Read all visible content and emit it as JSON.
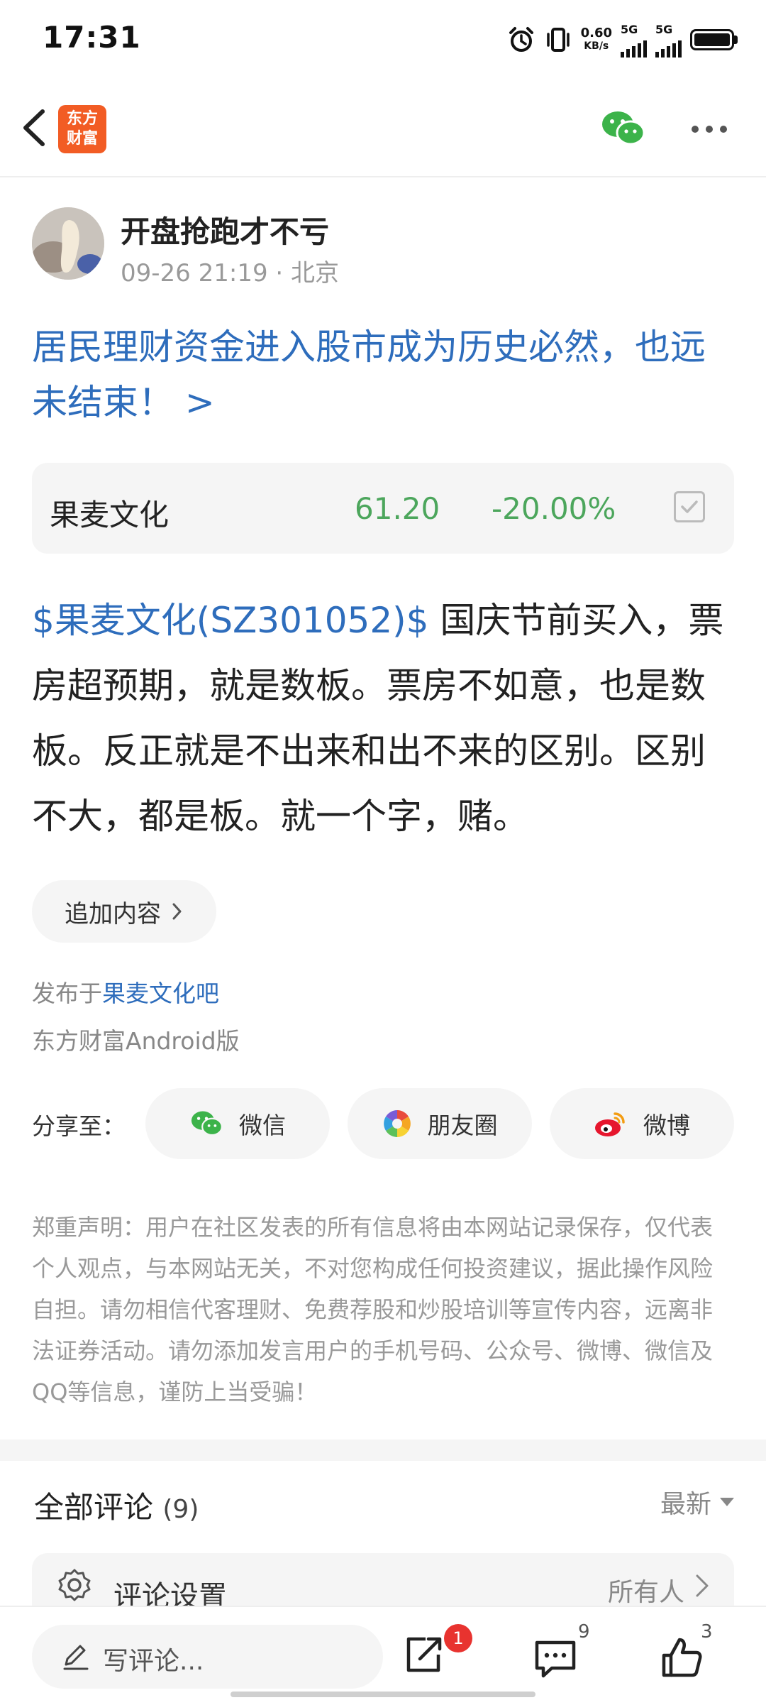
{
  "status_bar": {
    "time": "17:31",
    "net_speed_value": "0.60",
    "net_speed_unit": "KB/s",
    "signal1_label": "5G",
    "signal2_label": "5G"
  },
  "nav": {
    "logo_line1": "东方",
    "logo_line2": "财富"
  },
  "author": {
    "name": "开盘抢跑才不亏",
    "meta": "09-26 21:19 · 北京"
  },
  "post": {
    "title": "居民理财资金进入股市成为历史必然，也远未结束！ >",
    "stock_tag": "$果麦文化(SZ301052)$",
    "body": " 国庆节前买入，票房超预期，就是数板。票房不如意，也是数板。反正就是不出来和出不来的区别。区别不大，都是板。就一个字，赌。"
  },
  "stock_card": {
    "name": "果麦文化",
    "price": "61.20",
    "change": "-20.00%",
    "color_down": "#4ca65c"
  },
  "add_content_label": "追加内容",
  "publish": {
    "prefix": "发布于",
    "bar_name": "果麦文化吧",
    "client": "东方财富Android版"
  },
  "share": {
    "label": "分享至：",
    "wechat": "微信",
    "moments": "朋友圈",
    "weibo": "微博"
  },
  "disclaimer": "郑重声明：用户在社区发表的所有信息将由本网站记录保存，仅代表个人观点，与本网站无关，不对您构成任何投资建议，据此操作风险自担。请勿相信代客理财、免费荐股和炒股培训等宣传内容，远离非法证券活动。请勿添加发言用户的手机号码、公众号、微博、微信及QQ等信息，谨防上当受骗！",
  "comments": {
    "title": "全部评论",
    "count": "(9)",
    "sort_label": "最新",
    "settings_label": "评论设置",
    "settings_value": "所有人"
  },
  "bottom_bar": {
    "input_placeholder": "写评论...",
    "share_badge": "1",
    "comment_count": "9",
    "like_count": "3"
  },
  "colors": {
    "link_blue": "#2e6dbc",
    "brand_orange": "#f25c24",
    "badge_red": "#e8332f"
  }
}
